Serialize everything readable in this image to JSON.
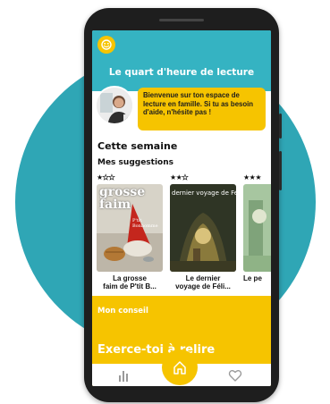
{
  "header": {
    "title": "Le quart d'heure de lecture"
  },
  "guide": {
    "message": "Bienvenue sur ton espace de lecture en famille. Si tu as besoin d'aide, n'hésite pas !"
  },
  "sections": {
    "week_title": "Cette semaine",
    "suggestions_title": "Mes suggestions"
  },
  "books": [
    {
      "stars_filled": 1,
      "stars_total": 3,
      "cover_title": "grosse faim",
      "cover_sub": "P'tit Bonhomme",
      "title_line1": "La grosse",
      "title_line2": "faim de P'tit B..."
    },
    {
      "stars_filled": 2,
      "stars_total": 3,
      "cover_title": "dernier voyage de Félic",
      "title_line1": "Le dernier",
      "title_line2": "voyage de Féli..."
    },
    {
      "stars_filled": 3,
      "stars_total": 3,
      "title_line1": "Le pe"
    }
  ],
  "conseil": {
    "label": "Mon conseil",
    "text": "Exerce-toi à relire"
  },
  "nav": {
    "items": [
      "stats-icon",
      "home-icon",
      "heart-icon"
    ]
  },
  "colors": {
    "teal": "#35b3c2",
    "yellow": "#f6c400",
    "circle": "#2fa6b5"
  }
}
